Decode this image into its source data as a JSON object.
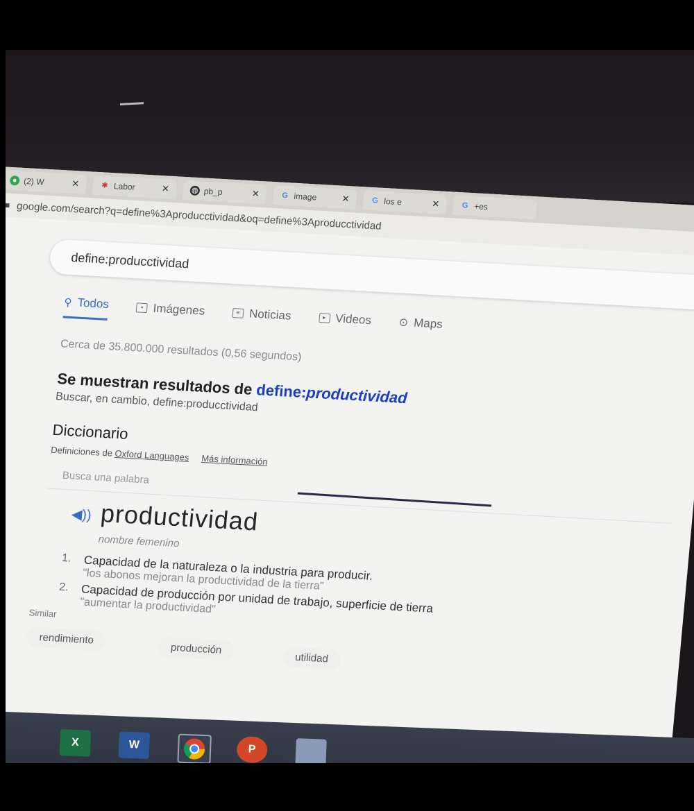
{
  "tabs": [
    {
      "label": "(2) W",
      "icon": "whatsapp-icon",
      "color": "#2fa84f"
    },
    {
      "label": "Labor",
      "icon": "labor-site-icon",
      "color": "#c0392b"
    },
    {
      "label": "pb_p",
      "icon": "globe-icon",
      "color": "#333333"
    },
    {
      "label": "image",
      "icon": "google-icon",
      "color": "#4285f4"
    },
    {
      "label": "los e",
      "icon": "google-icon",
      "color": "#4285f4"
    },
    {
      "label": "+es",
      "icon": "google-icon",
      "color": "#4285f4"
    }
  ],
  "address": {
    "url": "google.com/search?q=define%3Aproducctividad&oq=define%3Aproducctividad"
  },
  "search": {
    "query": "define:producctividad"
  },
  "search_tabs": [
    {
      "label": "Todos",
      "icon": "search-icon",
      "active": true
    },
    {
      "label": "Imágenes",
      "icon": "image-icon",
      "active": false
    },
    {
      "label": "Noticias",
      "icon": "news-icon",
      "active": false
    },
    {
      "label": "Videos",
      "icon": "video-icon",
      "active": false
    },
    {
      "label": "Maps",
      "icon": "map-pin-icon",
      "active": false
    }
  ],
  "results": {
    "stats": "Cerca de 35.800.000 resultados (0,56 segundos)",
    "showing_prefix": "Se muestran resultados de ",
    "showing_define": "define:",
    "showing_word": "productividad",
    "instead": "Buscar, en cambio, define:producctividad"
  },
  "dictionary": {
    "title": "Diccionario",
    "source_prefix": "Definiciones de ",
    "source_link": "Oxford Languages",
    "more_info": "Más información",
    "search_placeholder": "Busca una palabra",
    "headword": "productividad",
    "pos": "nombre femenino",
    "definitions": [
      {
        "num": "1.",
        "text": "Capacidad de la naturaleza o la industria para producir.",
        "example": "\"los abonos mejoran la productividad de la tierra\""
      },
      {
        "num": "2.",
        "text": "Capacidad de producción por unidad de trabajo, superficie de tierra",
        "example": "\"aumentar la productividad\""
      }
    ],
    "similar_label": "Similar",
    "synonyms": [
      "rendimiento",
      "producción",
      "utilidad"
    ]
  },
  "taskbar": {
    "apps": [
      {
        "label": "X",
        "icon": "excel-icon",
        "color": "#1e7145"
      },
      {
        "label": "W",
        "icon": "word-icon",
        "color": "#2b579a"
      },
      {
        "label": "",
        "icon": "chrome-icon",
        "color": "#db4437"
      },
      {
        "label": "P",
        "icon": "powerpoint-icon",
        "color": "#d24726"
      },
      {
        "label": "",
        "icon": "document-icon",
        "color": "#8a9ab8"
      }
    ]
  }
}
